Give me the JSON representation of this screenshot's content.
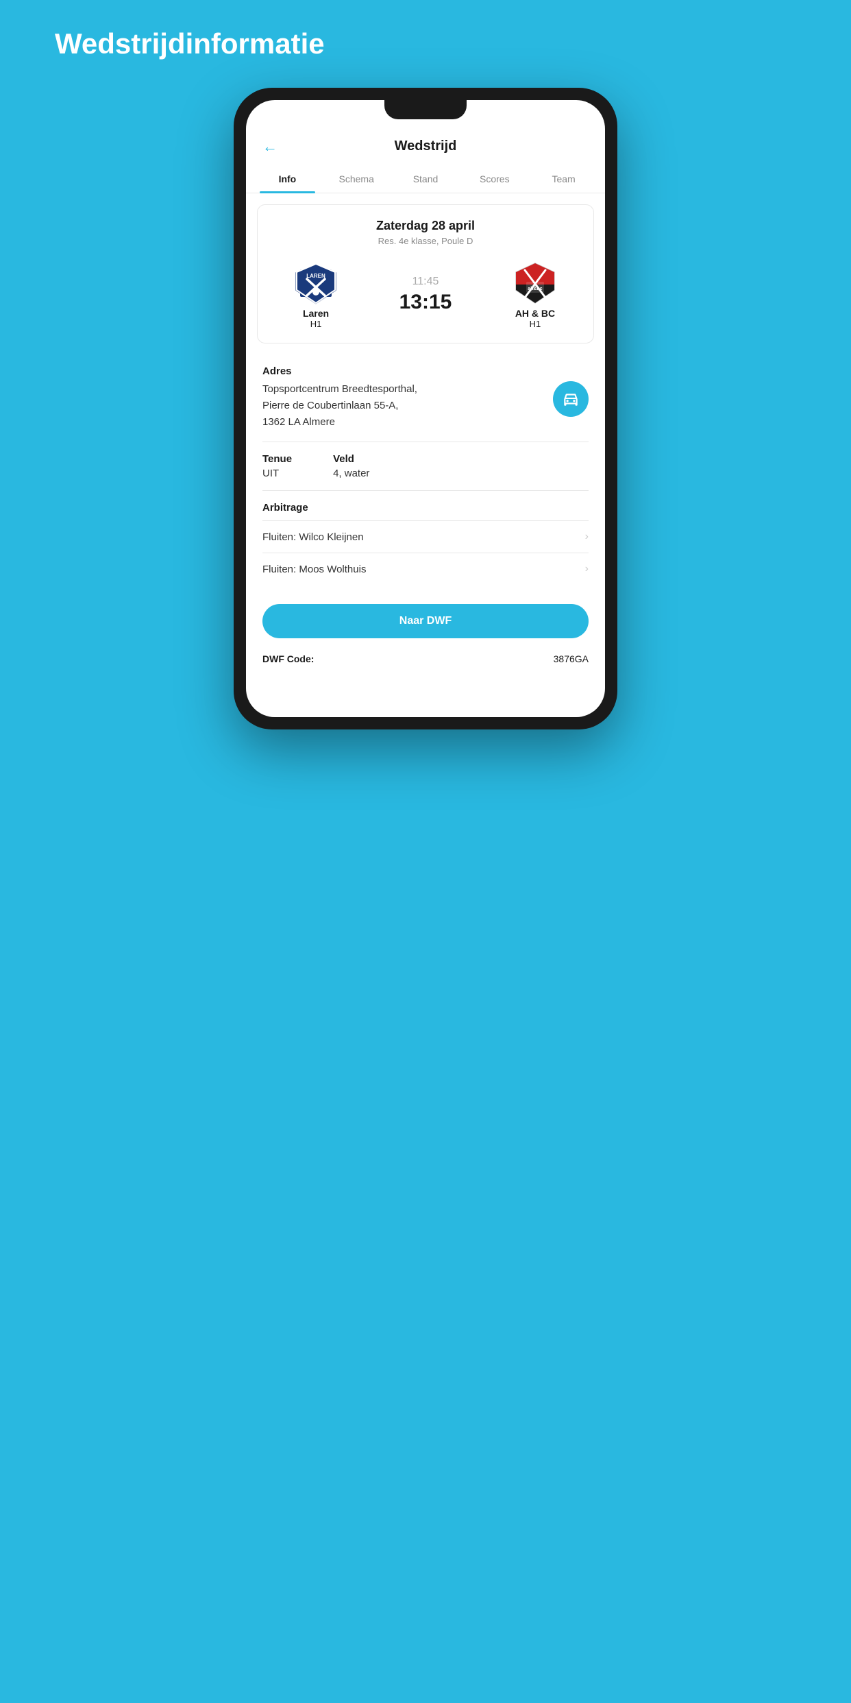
{
  "page": {
    "title": "Wedstrijdinformatie"
  },
  "header": {
    "back_icon": "←",
    "title": "Wedstrijd"
  },
  "tabs": [
    {
      "label": "Info",
      "active": true
    },
    {
      "label": "Schema",
      "active": false
    },
    {
      "label": "Stand",
      "active": false
    },
    {
      "label": "Scores",
      "active": false
    },
    {
      "label": "Team",
      "active": false
    }
  ],
  "match": {
    "date": "Zaterdag 28 april",
    "league": "Res. 4e klasse, Poule D",
    "time_original": "11:45",
    "time_current": "13:15",
    "home_team_name": "Laren",
    "home_team_sub": "H1",
    "away_team_name": "AH & BC",
    "away_team_sub": "H1"
  },
  "address": {
    "label": "Adres",
    "line1": "Topsportcentrum Breedtesporthal,",
    "line2": "Pierre de Coubertinlaan 55-A,",
    "line3": "1362 LA Almere",
    "nav_icon": "car"
  },
  "tenue": {
    "label": "Tenue",
    "value": "UIT"
  },
  "veld": {
    "label": "Veld",
    "value": "4, water"
  },
  "arbitrage": {
    "title": "Arbitrage",
    "items": [
      {
        "text": "Fluiten: Wilco Kleijnen"
      },
      {
        "text": "Fluiten: Moos Wolthuis"
      }
    ]
  },
  "naar_dwf": {
    "label": "Naar DWF"
  },
  "dwf_code": {
    "label": "DWF Code:",
    "value": "3876GA"
  }
}
